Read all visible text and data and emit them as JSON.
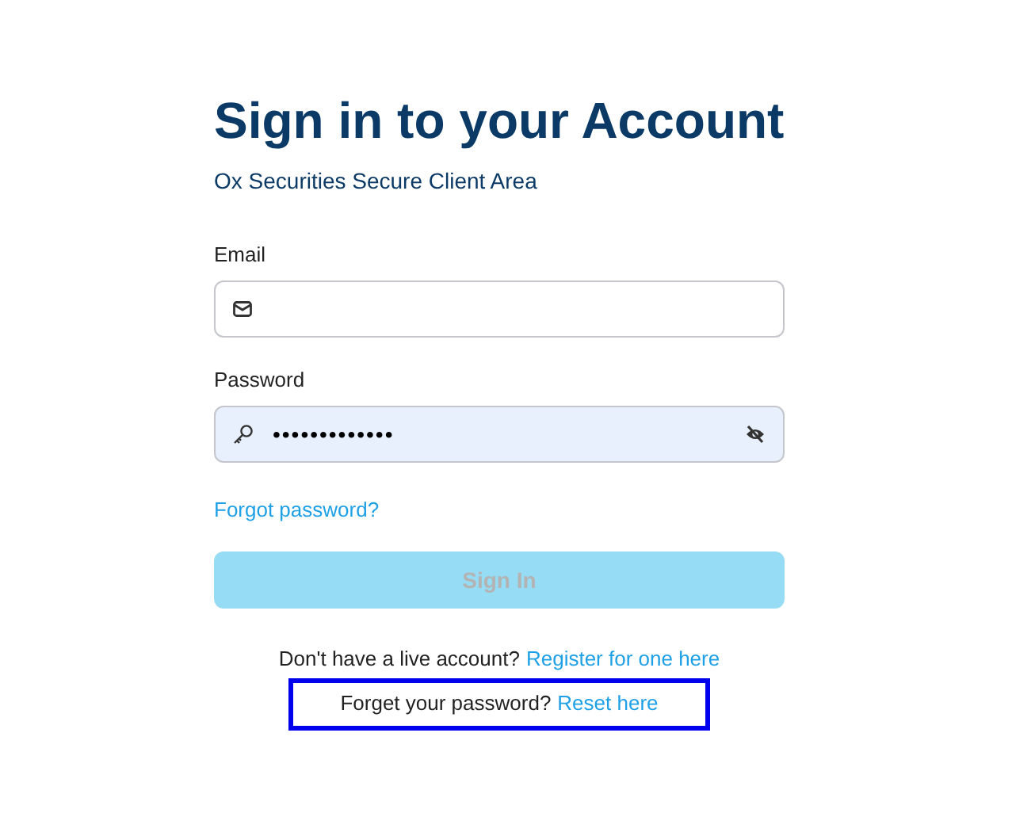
{
  "title": "Sign in to your Account",
  "subtitle": "Ox Securities Secure Client Area",
  "fields": [
    {
      "kind": "email",
      "label": "Email"
    },
    {
      "kind": "password",
      "label": "Password",
      "value": "•••••••••••••",
      "filled": true
    }
  ],
  "forgot_link": "Forgot password?",
  "submit": {
    "label": "Sign In",
    "disabled": true
  },
  "footer": [
    {
      "text": "Don't have a live account?",
      "link": "Register for one here",
      "highlighted": false
    },
    {
      "text": "Forget your password?",
      "link": "Reset here",
      "highlighted": true
    }
  ]
}
